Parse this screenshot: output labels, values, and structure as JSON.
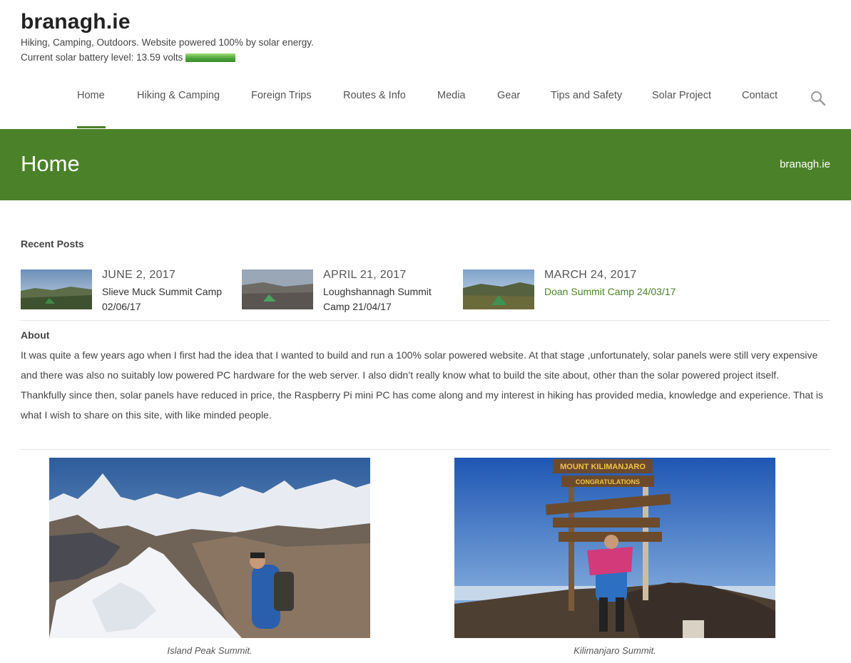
{
  "site": {
    "title": "branagh.ie",
    "tagline": "Hiking, Camping, Outdoors. Website powered 100% by solar energy.",
    "battery_text": "Current solar battery level: 13.59 volts"
  },
  "nav": {
    "items": [
      "Home",
      "Hiking & Camping",
      "Foreign Trips",
      "Routes & Info",
      "Media",
      "Gear",
      "Tips and Safety",
      "Solar Project",
      "Contact"
    ],
    "active": "Home",
    "search_icon": "search-icon"
  },
  "banner": {
    "title": "Home",
    "breadcrumb": "branagh.ie"
  },
  "recent_posts": {
    "heading": "Recent Posts",
    "posts": [
      {
        "date": "JUNE 2, 2017",
        "title": "Slieve Muck Summit Camp 02/06/17"
      },
      {
        "date": "APRIL 21, 2017",
        "title": "Loughshannagh Summit Camp 21/04/17"
      },
      {
        "date": "MARCH 24, 2017",
        "title": "Doan Summit Camp 24/03/17"
      }
    ]
  },
  "about": {
    "heading": "About",
    "paragraphs": [
      "It was quite a few years ago when I first had the idea that I wanted to build and run a 100% solar powered website. At that stage ,unfortunately, solar panels were still very expensive and there was also no suitably low powered PC hardware for the web server. I also didn’t really know what to build the site about, other than the solar powered project itself.",
      "Thankfully since then, solar panels have reduced in price, the Raspberry Pi mini PC has come along and my interest in hiking has provided media, knowledge and experience. That is what I wish to share on this site, with like minded people."
    ]
  },
  "gallery": {
    "captions": [
      "Island Peak Summit.",
      "Kilimanjaro Summit."
    ],
    "sign_texts": [
      "MOUNT KILIMANJARO",
      "CONGRATULATIONS"
    ]
  },
  "colors": {
    "brand_green": "#4b8229",
    "text": "#444444"
  }
}
